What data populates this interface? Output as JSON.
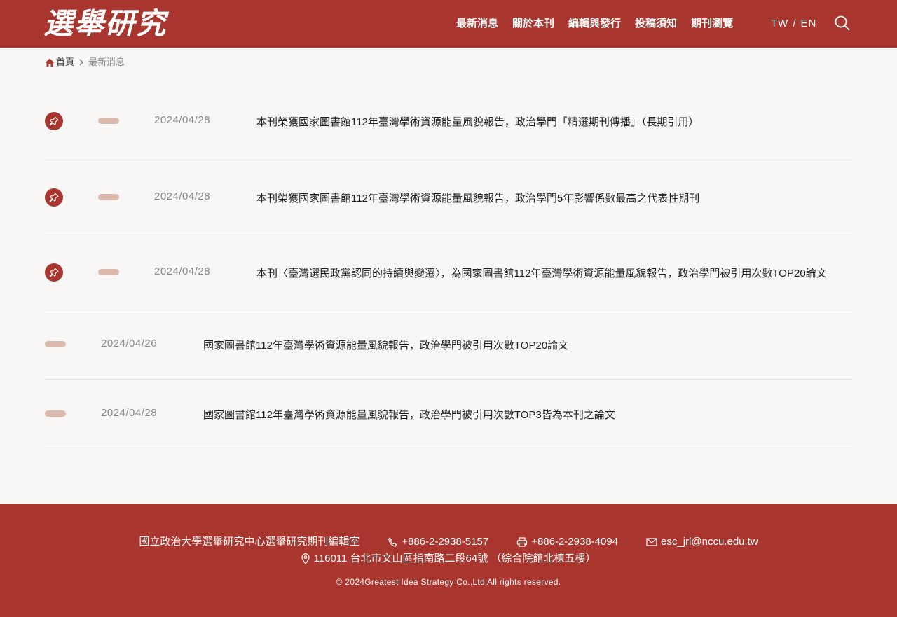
{
  "header": {
    "logo_text": "選舉研究",
    "nav": [
      "最新消息",
      "關於本刊",
      "編輯與發行",
      "投稿須知",
      "期刊瀏覽"
    ],
    "lang_tw": "TW",
    "lang_sep": "/",
    "lang_en": "EN"
  },
  "breadcrumb": {
    "home": "首頁",
    "current": "最新消息"
  },
  "news": [
    {
      "pinned": true,
      "date": "2024/04/28",
      "title": "本刊榮獲國家圖書館112年臺灣學術資源能量風貌報告，政治學門「精選期刊傳播」（長期引用）"
    },
    {
      "pinned": true,
      "date": "2024/04/28",
      "title": "本刊榮獲國家圖書館112年臺灣學術資源能量風貌報告，政治學門5年影響係數最高之代表性期刊"
    },
    {
      "pinned": true,
      "date": "2024/04/28",
      "title": "本刊〈臺灣選民政黨認同的持續與變遷〉，為國家圖書館112年臺灣學術資源能量風貌報告，政治學門被引用次數TOP20論文"
    },
    {
      "pinned": false,
      "date": "2024/04/26",
      "title": "國家圖書館112年臺灣學術資源能量風貌報告，政治學門被引用次數TOP20論文"
    },
    {
      "pinned": false,
      "date": "2024/04/28",
      "title": "國家圖書館112年臺灣學術資源能量風貌報告，政治學門被引用次數TOP3皆為本刊之論文"
    }
  ],
  "footer": {
    "org": "國立政治大學選舉研究中心選舉研究期刊編輯室",
    "phone": "+886-2-2938-5157",
    "fax": "+886-2-2938-4094",
    "email": "esc_jrl@nccu.edu.tw",
    "address": "116011 台北市文山區指南路二段64號 （綜合院館北棟五樓）",
    "copyright": "© 2024Greatest Idea Strategy Co.,Ltd All rights reserved."
  },
  "colors": {
    "brand": "#a8352e",
    "tag": "#dbb9ad",
    "background": "#f9f7f6"
  }
}
